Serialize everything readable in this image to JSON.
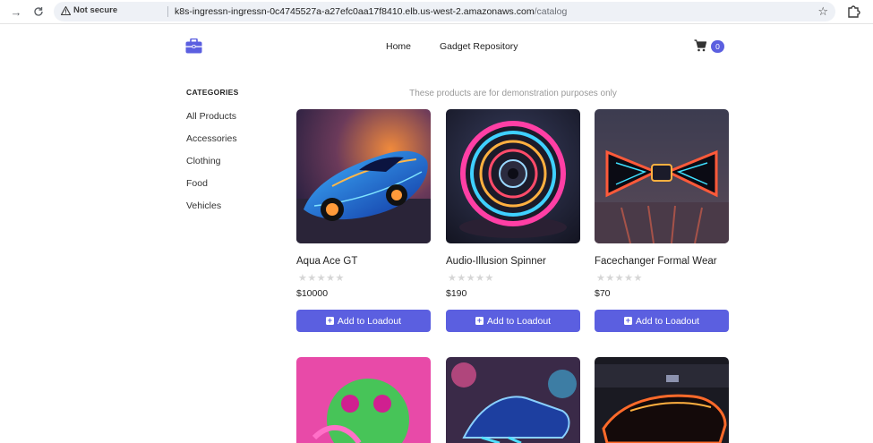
{
  "browser": {
    "security_label": "Not secure",
    "url_host": "k8s-ingressn-ingressn-0c4745527a-a27efc0aa17f8410.elb.us-west-2.amazonaws.com",
    "url_path": "/catalog"
  },
  "header": {
    "nav": [
      "Home",
      "Gadget Repository"
    ],
    "cart_count": "0",
    "brand_color": "#5b5fe0"
  },
  "sidebar": {
    "title": "CATEGORIES",
    "items": [
      "All Products",
      "Accessories",
      "Clothing",
      "Food",
      "Vehicles"
    ]
  },
  "catalog": {
    "note": "These products are for demonstration purposes only",
    "button_label": "Add to Loadout",
    "products": [
      {
        "name": "Aqua Ace GT",
        "price": "$10000",
        "rating": 0,
        "image": "neon-car"
      },
      {
        "name": "Audio-Illusion Spinner",
        "price": "$190",
        "rating": 0,
        "image": "neon-spinner"
      },
      {
        "name": "Facechanger Formal Wear",
        "price": "$70",
        "rating": 0,
        "image": "neon-bowtie"
      }
    ],
    "more_products_images": [
      "neon-frog",
      "neon-shoes",
      "neon-racecar"
    ]
  }
}
